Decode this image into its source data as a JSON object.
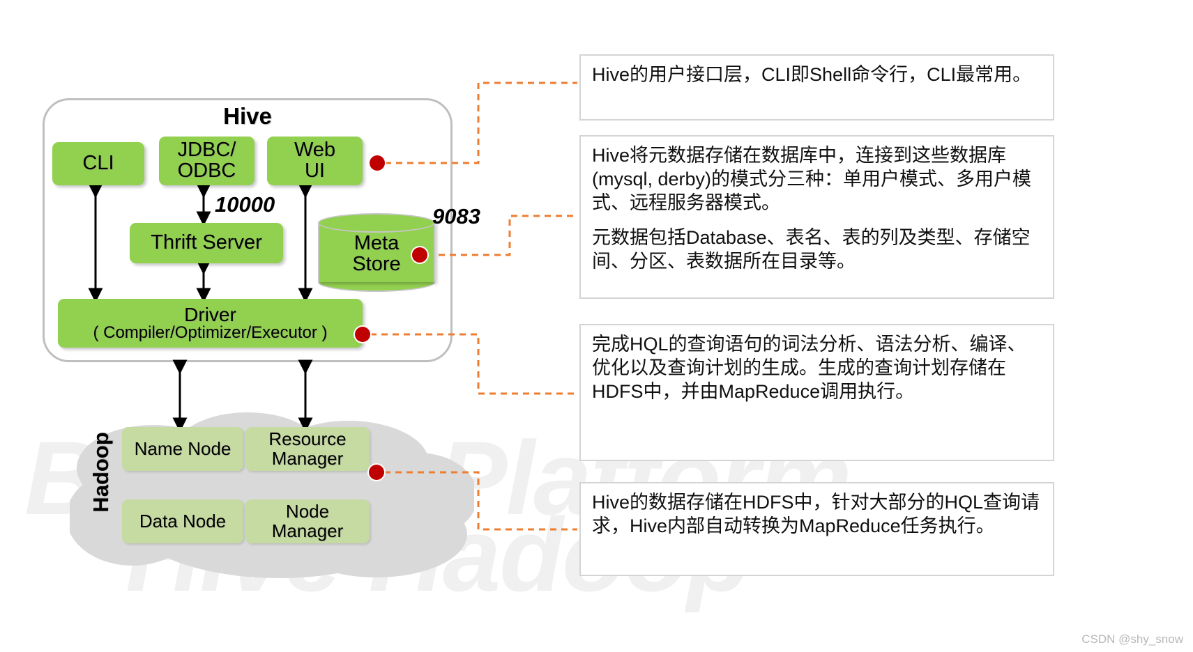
{
  "diagram": {
    "title": "Hive",
    "hadoop_label": "Hadoop",
    "credit": "CSDN @shy_snow",
    "watermark_line1": "BigData Platform",
    "watermark_line2": "Hive Hadoop",
    "colors": {
      "hive_component_green": "#92D050",
      "hadoop_component_green": "#C6DBA2",
      "cloud_gray": "#D9D9D9",
      "connector_orange": "#ED7D31",
      "connector_dot_red": "#C00000",
      "frame_gray": "#BFBFBF",
      "note_border": "#D4D4D4"
    }
  },
  "hive": {
    "components": [
      {
        "id": "cli",
        "label": "CLI"
      },
      {
        "id": "jdbc",
        "label_line1": "JDBC/",
        "label_line2": "ODBC"
      },
      {
        "id": "webui",
        "label_line1": "Web",
        "label_line2": "UI"
      },
      {
        "id": "thrift",
        "label": "Thrift Server"
      },
      {
        "id": "driver",
        "label_line1": "Driver",
        "label_line2": "( Compiler/Optimizer/Executor )"
      },
      {
        "id": "metastore",
        "label_line1": "Meta",
        "label_line2": "Store"
      }
    ],
    "ports": [
      {
        "id": "thrift-port",
        "value": "10000"
      },
      {
        "id": "metastore-port",
        "value": "9083"
      }
    ]
  },
  "hadoop": {
    "components": [
      {
        "id": "name-node",
        "label_line1": "Name Node",
        "label_line2": ""
      },
      {
        "id": "resource-manager",
        "label_line1": "Resource",
        "label_line2": "Manager"
      },
      {
        "id": "data-node",
        "label_line1": "Data Node",
        "label_line2": ""
      },
      {
        "id": "node-manager",
        "label_line1": "Node",
        "label_line2": "Manager"
      }
    ]
  },
  "notes": [
    {
      "id": "note-user-interface",
      "target": "Web UI / CLI / JDBC-ODBC",
      "paragraphs": [
        "Hive的用户接口层，CLI即Shell命令行，CLI最常用。"
      ]
    },
    {
      "id": "note-metastore",
      "target": "Meta Store",
      "paragraphs": [
        "Hive将元数据存储在数据库中，连接到这些数据库(mysql, derby)的模式分三种：单用户模式、多用户模式、远程服务器模式。",
        "元数据包括Database、表名、表的列及类型、存储空间、分区、表数据所在目录等。"
      ]
    },
    {
      "id": "note-driver",
      "target": "Driver",
      "paragraphs": [
        "完成HQL的查询语句的词法分析、语法分析、编译、优化以及查询计划的生成。生成的查询计划存储在HDFS中，并由MapReduce调用执行。"
      ]
    },
    {
      "id": "note-hadoop",
      "target": "Hadoop",
      "paragraphs": [
        "Hive的数据存储在HDFS中，针对大部分的HQL查询请求，Hive内部自动转换为MapReduce任务执行。"
      ]
    }
  ]
}
